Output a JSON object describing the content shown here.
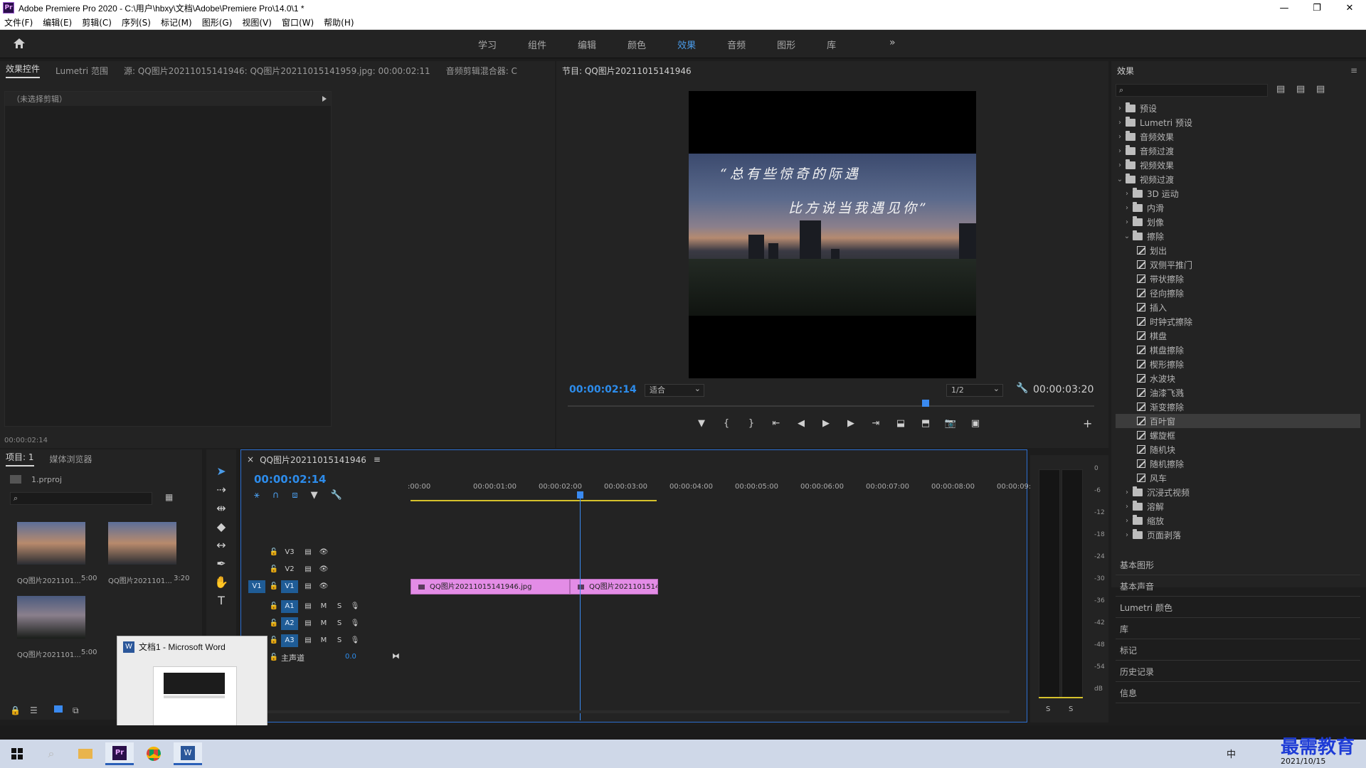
{
  "app": {
    "title": "Adobe Premiere Pro 2020 - C:\\用户\\hbxy\\文档\\Adobe\\Premiere Pro\\14.0\\1 *",
    "logo": "Pr"
  },
  "menu": [
    "文件(F)",
    "编辑(E)",
    "剪辑(C)",
    "序列(S)",
    "标记(M)",
    "图形(G)",
    "视图(V)",
    "窗口(W)",
    "帮助(H)"
  ],
  "workspaces": {
    "tabs": [
      "学习",
      "组件",
      "编辑",
      "颜色",
      "效果",
      "音频",
      "图形",
      "库"
    ],
    "active": "效果",
    "more": "»"
  },
  "effect_controls": {
    "tabs": [
      "效果控件",
      "Lumetri 范围",
      "源: QQ图片20211015141946: QQ图片20211015141959.jpg: 00:00:02:11",
      "音频剪辑混合器: C"
    ],
    "no_clip": "（未选择剪辑）",
    "timecode": "00:00:02:14"
  },
  "program_monitor": {
    "title": "节目: QQ图片20211015141946",
    "caption_line1": "“总有些惊奇的际遇",
    "caption_line2": "比方说当我遇见你”",
    "current_time": "00:00:02:14",
    "fit": "适合",
    "resolution": "1/2",
    "duration": "00:00:03:20",
    "playhead_fraction": 0.68
  },
  "effects": {
    "title": "效果",
    "top_items": [
      "预设",
      "Lumetri 预设",
      "音频效果",
      "音频过渡",
      "视频效果",
      "视频过渡"
    ],
    "video_transition_children": [
      "3D 运动",
      "内滑",
      "划像",
      "擦除"
    ],
    "wipe_items": [
      "划出",
      "双侧平推门",
      "带状擦除",
      "径向擦除",
      "插入",
      "时钟式擦除",
      "棋盘",
      "棋盘擦除",
      "楔形擦除",
      "水波块",
      "油漆飞溅",
      "渐变擦除",
      "百叶窗",
      "螺旋框",
      "随机块",
      "随机擦除",
      "风车"
    ],
    "selected": "百叶窗",
    "after_items": [
      "沉浸式视频",
      "溶解",
      "缩放",
      "页面剥落"
    ],
    "sections": [
      "基本图形",
      "基本声音",
      "Lumetri 颜色",
      "库",
      "标记",
      "历史记录",
      "信息"
    ]
  },
  "project": {
    "tabs": [
      "项目: 1",
      "媒体浏览器"
    ],
    "file": "1.prproj",
    "items": [
      {
        "name": "QQ图片2021101...",
        "duration": "5:00"
      },
      {
        "name": "QQ图片2021101...",
        "duration": "3:20"
      },
      {
        "name": "QQ图片2021101...",
        "duration": "5:00"
      }
    ]
  },
  "timeline": {
    "title": "QQ图片20211015141946",
    "close": "×",
    "timecode": "00:00:02:14",
    "ruler": [
      ":00:00",
      "00:00:01:00",
      "00:00:02:00",
      "00:00:03:00",
      "00:00:04:00",
      "00:00:05:00",
      "00:00:06:00",
      "00:00:07:00",
      "00:00:08:00",
      "00:00:09:"
    ],
    "video_tracks": [
      "V3",
      "V2",
      "V1"
    ],
    "audio_tracks": [
      "A1",
      "A2",
      "A3"
    ],
    "source_patch": "V1",
    "master_label": "主声道",
    "master_value": "0.0",
    "mute": "M",
    "solo": "S",
    "clip1": "QQ图片20211015141946.jpg",
    "clip2": "QQ图片20211015141",
    "clip_color": "#e38ce6"
  },
  "meter": {
    "labels": [
      "0",
      "-6",
      "-12",
      "-18",
      "-24",
      "-30",
      "-36",
      "-42",
      "-48",
      "-54",
      "dB"
    ],
    "solo_labels": [
      "S",
      "S"
    ]
  },
  "word_preview": {
    "title": "文档1 - Microsoft Word"
  },
  "taskbar": {
    "date": "2021/10/15",
    "watermark": "最需教育",
    "ime": "中"
  }
}
